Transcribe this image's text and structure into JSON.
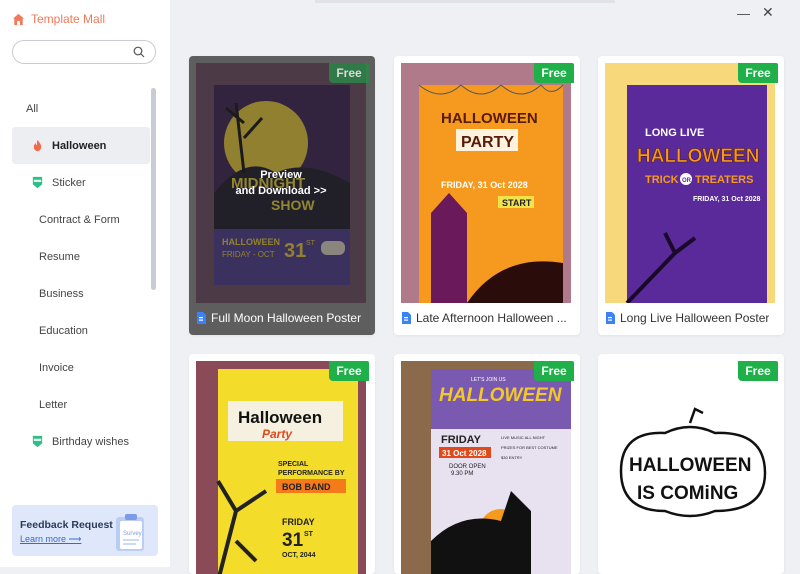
{
  "brand": {
    "title": "Template Mall"
  },
  "search": {
    "value": "",
    "placeholder": ""
  },
  "sidebar": {
    "items": [
      {
        "label": "All"
      },
      {
        "label": "Halloween"
      },
      {
        "label": "Sticker"
      },
      {
        "label": "Contract & Form"
      },
      {
        "label": "Resume"
      },
      {
        "label": "Business"
      },
      {
        "label": "Education"
      },
      {
        "label": "Invoice"
      },
      {
        "label": "Letter"
      },
      {
        "label": "Birthday wishes"
      }
    ]
  },
  "feedback": {
    "title": "Feedback Request",
    "link": "Learn more ⟶",
    "art_text": "Survey"
  },
  "badge_label": "Free",
  "overlay": {
    "line1": "Preview",
    "line2": "and Download >>"
  },
  "cards": [
    {
      "title": "Full Moon Halloween Poster",
      "poster": {
        "headline1": "MIDNIGHT",
        "headline2": "SHOW",
        "brand": "HALLOWEEN",
        "date": "FRIDAY - OCT",
        "day": "31",
        "day_sup": "ST"
      }
    },
    {
      "title": "Late Afternoon Halloween ...",
      "poster": {
        "headline1": "HALLOWEEN",
        "headline2": "PARTY",
        "date": "FRIDAY, 31 Oct 2028",
        "start": "START"
      }
    },
    {
      "title": "Long Live Halloween Poster",
      "poster": {
        "line1": "LONG LIVE",
        "line2": "HALLOWEEN",
        "line3": "TRICK",
        "or": "OR",
        "line4": "TREATERS",
        "date": "FRIDAY, 31 Oct 2028"
      }
    },
    {
      "title": "",
      "poster": {
        "headline1": "Halloween",
        "headline2": "Party",
        "special1": "SPECIAL",
        "special2": "PERFORMANCE BY",
        "band": "BOB BAND",
        "day": "FRIDAY",
        "num": "31",
        "num_sup": "ST",
        "oct": "OCT, 2044"
      }
    },
    {
      "title": "",
      "poster": {
        "top": "LET'S JOIN US",
        "headline": "HALLOWEEN",
        "day": "FRIDAY",
        "date": "31 Oct 2028",
        "feat1": "LIVE MUSIC ALL NIGHT",
        "feat2": "PRIZES FOR BEST COSTUME",
        "feat3": "$30 ENTRY",
        "door": "DOOR OPEN",
        "time": "9.30 PM"
      }
    },
    {
      "title": "",
      "poster": {
        "line1": "HALLOWEEN",
        "line2": "IS COMiNG"
      }
    }
  ]
}
